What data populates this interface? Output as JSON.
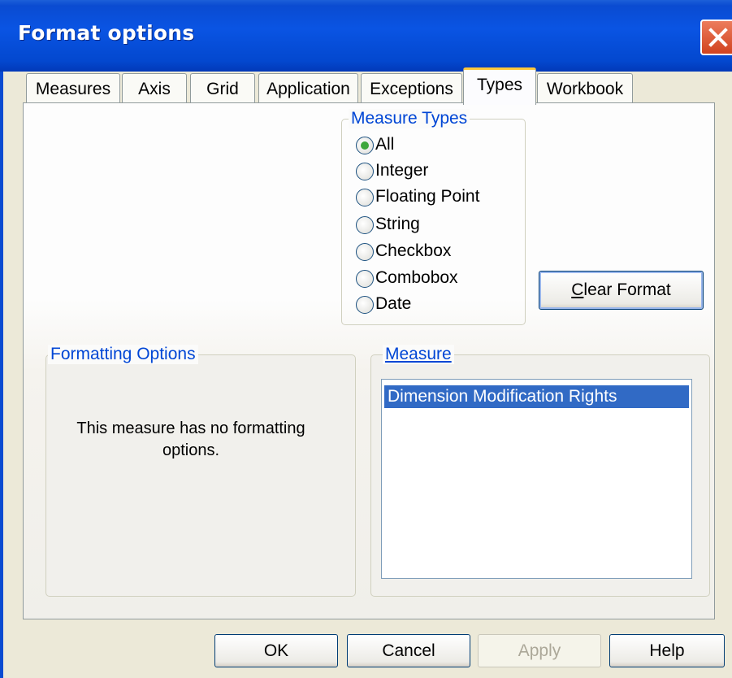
{
  "window": {
    "title": "Format options"
  },
  "tabs": [
    {
      "label": "Measures",
      "active": false
    },
    {
      "label": "Axis",
      "active": false
    },
    {
      "label": "Grid",
      "active": false
    },
    {
      "label": "Application",
      "active": false
    },
    {
      "label": "Exceptions",
      "active": false
    },
    {
      "label": "Types",
      "active": true
    },
    {
      "label": "Workbook",
      "active": false
    }
  ],
  "measure_types": {
    "legend": "Measure Types",
    "selected": "All",
    "options": [
      "All",
      "Integer",
      "Floating Point",
      "String",
      "Checkbox",
      "Combobox",
      "Date"
    ]
  },
  "clear_format": {
    "label": "Clear Format",
    "mnemonic": "C"
  },
  "formatting_options": {
    "legend": "Formatting Options",
    "message": "This measure has no formatting options."
  },
  "measure": {
    "legend": "Measure",
    "items": [
      {
        "label": "Dimension Modification Rights",
        "selected": true
      }
    ]
  },
  "buttons": {
    "ok": "OK",
    "cancel": "Cancel",
    "apply": "Apply",
    "apply_enabled": false,
    "help": "Help"
  },
  "colors": {
    "titlebar": "#0a54e3",
    "group_label": "#0046d5",
    "selection": "#316ac5",
    "active_tab_accent": "#ffc83c"
  }
}
